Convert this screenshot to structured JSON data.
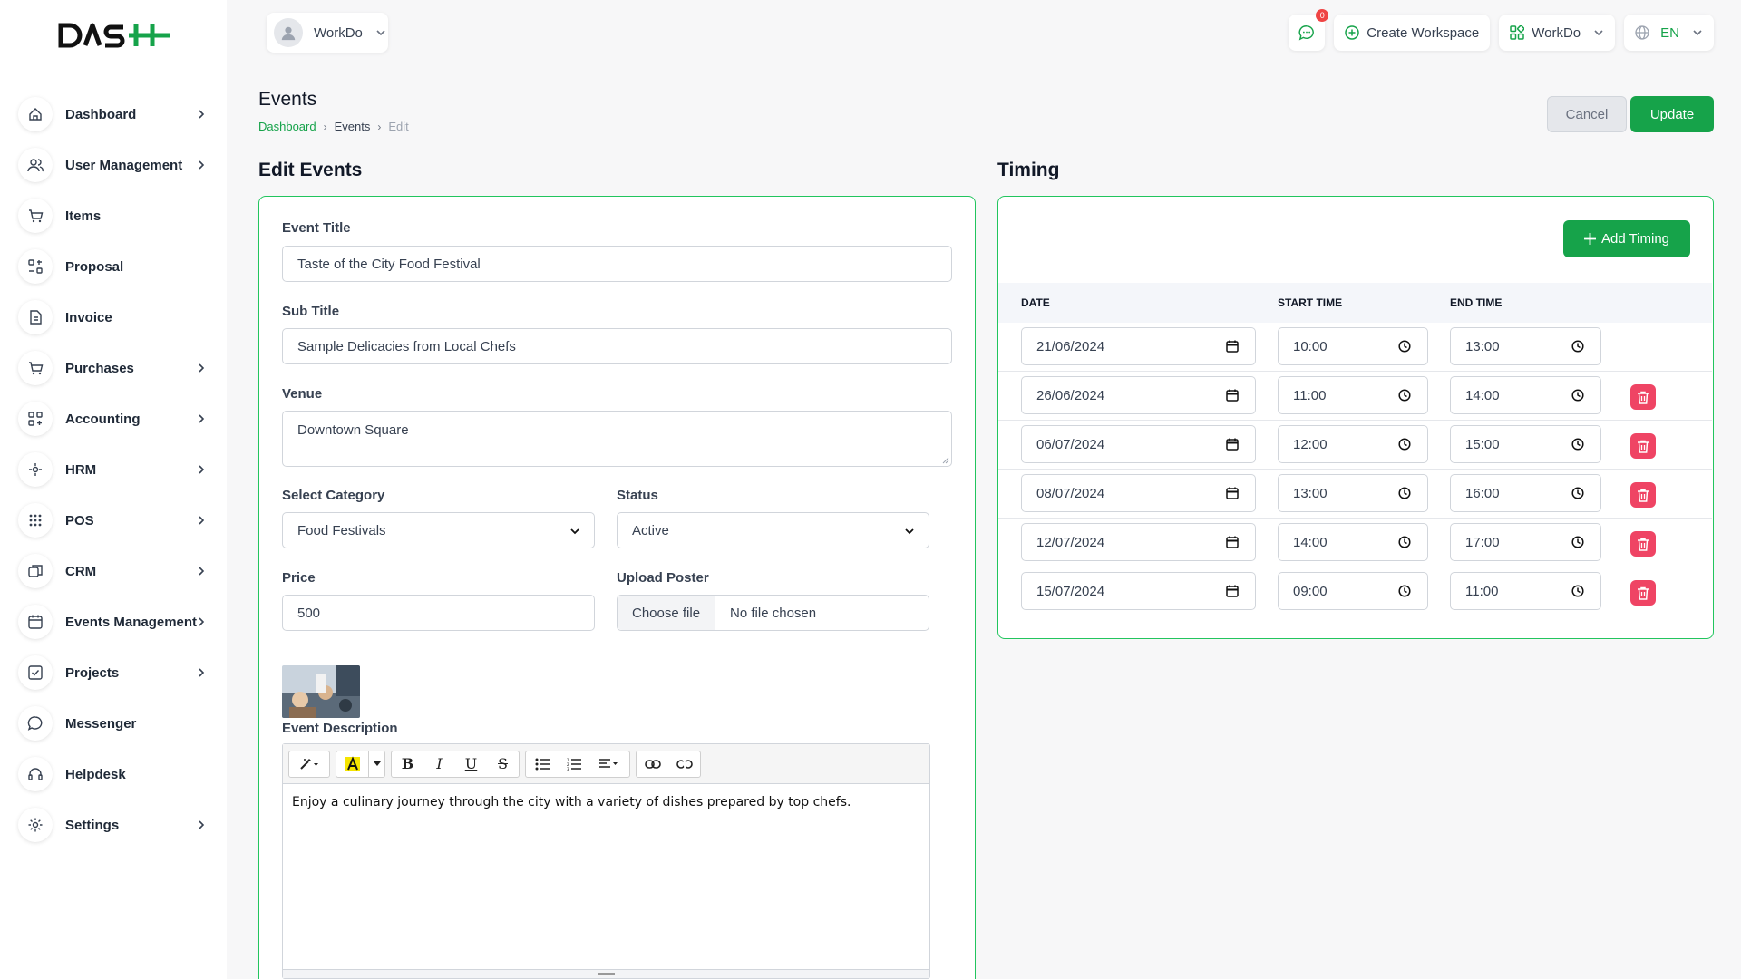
{
  "sidebar": {
    "items": [
      {
        "label": "Dashboard",
        "icon": "home-icon",
        "chevron": true
      },
      {
        "label": "User Management",
        "icon": "users-icon",
        "chevron": true
      },
      {
        "label": "Items",
        "icon": "cart-icon",
        "chevron": false
      },
      {
        "label": "Proposal",
        "icon": "proposal-icon",
        "chevron": false
      },
      {
        "label": "Invoice",
        "icon": "invoice-icon",
        "chevron": false
      },
      {
        "label": "Purchases",
        "icon": "cart-icon",
        "chevron": true
      },
      {
        "label": "Accounting",
        "icon": "grid-icon",
        "chevron": true
      },
      {
        "label": "HRM",
        "icon": "hrm-icon",
        "chevron": true
      },
      {
        "label": "POS",
        "icon": "pos-grid-icon",
        "chevron": true
      },
      {
        "label": "CRM",
        "icon": "crm-icon",
        "chevron": true
      },
      {
        "label": "Events Management",
        "icon": "calendar-icon",
        "chevron": true
      },
      {
        "label": "Projects",
        "icon": "checkbox-icon",
        "chevron": true
      },
      {
        "label": "Messenger",
        "icon": "chat-icon",
        "chevron": false
      },
      {
        "label": "Helpdesk",
        "icon": "headset-icon",
        "chevron": false
      },
      {
        "label": "Settings",
        "icon": "gear-icon",
        "chevron": true
      }
    ]
  },
  "topbar": {
    "workspace_name": "WorkDo",
    "notification_count": "0",
    "create_workspace": "Create Workspace",
    "workspace_switch": "WorkDo",
    "language": "EN"
  },
  "page": {
    "title": "Events",
    "breadcrumb": [
      "Dashboard",
      "Events",
      "Edit"
    ],
    "cancel": "Cancel",
    "update": "Update"
  },
  "form": {
    "section_title": "Edit Events",
    "event_title_label": "Event Title",
    "event_title_value": "Taste of the City Food Festival",
    "sub_title_label": "Sub Title",
    "sub_title_value": "Sample Delicacies from Local Chefs",
    "venue_label": "Venue",
    "venue_value": "Downtown Square",
    "category_label": "Select Category",
    "category_value": "Food Festivals",
    "status_label": "Status",
    "status_value": "Active",
    "price_label": "Price",
    "price_value": "500",
    "poster_label": "Upload Poster",
    "choose_file": "Choose file",
    "no_file": "No file chosen",
    "description_label": "Event Description",
    "description_value": "Enjoy a culinary journey through the city with a variety of dishes prepared by top chefs."
  },
  "timing": {
    "section_title": "Timing",
    "add_button": "Add Timing",
    "headers": [
      "DATE",
      "START TIME",
      "END TIME"
    ],
    "rows": [
      {
        "date": "21/06/2024",
        "start": "10:00",
        "end": "13:00",
        "deletable": false
      },
      {
        "date": "26/06/2024",
        "start": "11:00",
        "end": "14:00",
        "deletable": true
      },
      {
        "date": "06/07/2024",
        "start": "12:00",
        "end": "15:00",
        "deletable": true
      },
      {
        "date": "08/07/2024",
        "start": "13:00",
        "end": "16:00",
        "deletable": true
      },
      {
        "date": "12/07/2024",
        "start": "14:00",
        "end": "17:00",
        "deletable": true
      },
      {
        "date": "15/07/2024",
        "start": "09:00",
        "end": "11:00",
        "deletable": true
      }
    ]
  },
  "colors": {
    "accent": "#16a34a",
    "danger": "#ef4464",
    "border": "#22c55e"
  }
}
